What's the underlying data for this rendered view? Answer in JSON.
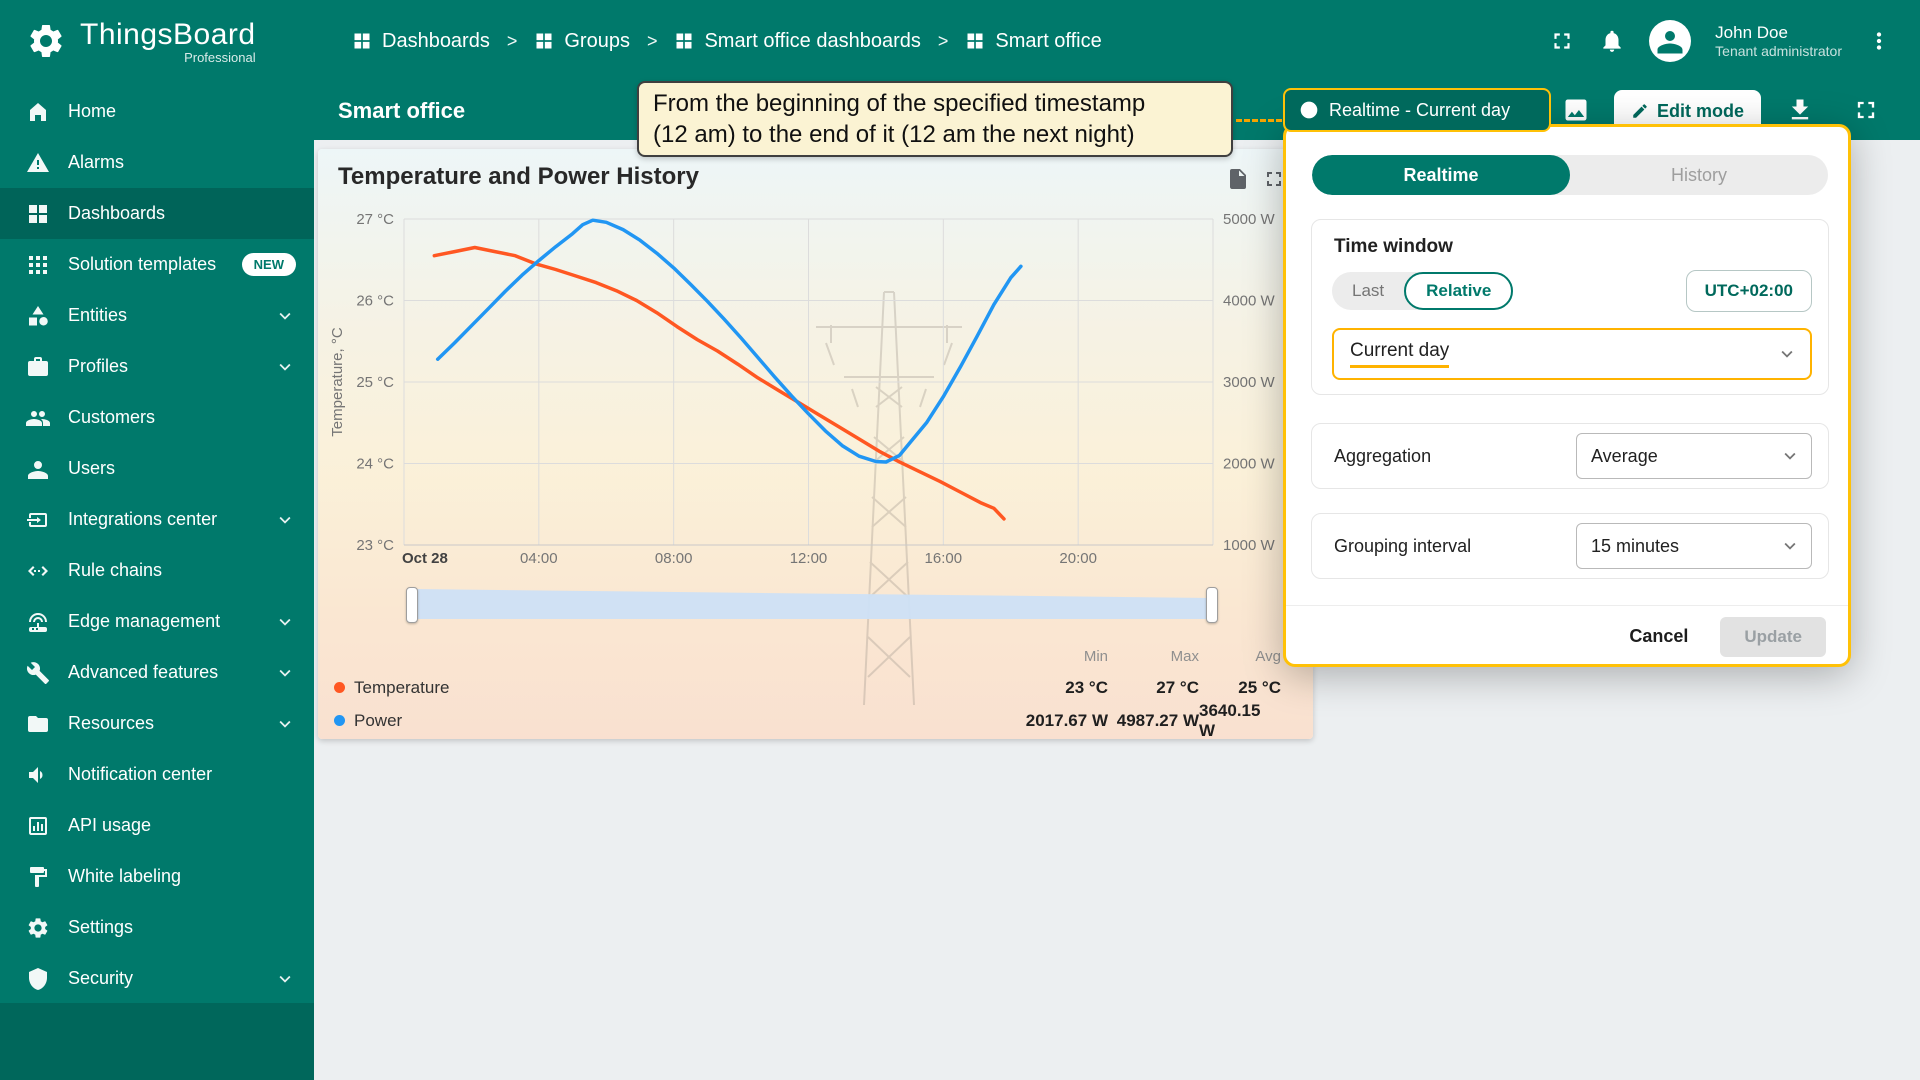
{
  "app": {
    "name": "ThingsBoard",
    "subtitle": "Professional"
  },
  "header": {
    "breadcrumbs": [
      {
        "label": "Dashboards"
      },
      {
        "label": "Groups"
      },
      {
        "label": "Smart office dashboards"
      },
      {
        "label": "Smart office"
      }
    ],
    "user": {
      "name": "John Doe",
      "role": "Tenant administrator"
    }
  },
  "sidebar": {
    "items": [
      {
        "label": "Home",
        "icon": "home-icon"
      },
      {
        "label": "Alarms",
        "icon": "alarms-icon"
      },
      {
        "label": "Dashboards",
        "icon": "dashboards-icon",
        "active": true
      },
      {
        "label": "Solution templates",
        "icon": "solution-templates-icon",
        "badge": "NEW"
      },
      {
        "label": "Entities",
        "icon": "entities-icon",
        "expandable": true
      },
      {
        "label": "Profiles",
        "icon": "profiles-icon",
        "expandable": true
      },
      {
        "label": "Customers",
        "icon": "customers-icon"
      },
      {
        "label": "Users",
        "icon": "users-icon"
      },
      {
        "label": "Integrations center",
        "icon": "integrations-icon",
        "expandable": true
      },
      {
        "label": "Rule chains",
        "icon": "rule-chains-icon"
      },
      {
        "label": "Edge management",
        "icon": "edge-management-icon",
        "expandable": true
      },
      {
        "label": "Advanced features",
        "icon": "advanced-features-icon",
        "expandable": true
      },
      {
        "label": "Resources",
        "icon": "resources-icon",
        "expandable": true
      },
      {
        "label": "Notification center",
        "icon": "notification-center-icon"
      },
      {
        "label": "API usage",
        "icon": "api-usage-icon"
      },
      {
        "label": "White labeling",
        "icon": "white-labeling-icon"
      },
      {
        "label": "Settings",
        "icon": "settings-icon"
      },
      {
        "label": "Security",
        "icon": "security-icon",
        "expandable": true
      }
    ]
  },
  "toolbar": {
    "title": "Smart office",
    "timewindow_button": "Realtime - Current day",
    "edit_button": "Edit mode"
  },
  "annotation": {
    "line1": "From the beginning of the specified timestamp",
    "line2": "(12 am) to the end of it (12 am the next night)"
  },
  "widget": {
    "title": "Temperature and Power History"
  },
  "chart_data": {
    "type": "line",
    "title": "Temperature and Power History",
    "x_ticks": [
      "Oct 28",
      "04:00",
      "08:00",
      "12:00",
      "16:00",
      "20:00"
    ],
    "x_tick_hours": [
      0,
      4,
      8,
      12,
      16,
      20
    ],
    "x_range_hours": [
      0,
      24
    ],
    "grid": true,
    "y_left": {
      "label": "Temperature, °C",
      "ticks": [
        "27 °C",
        "26 °C",
        "25 °C",
        "24 °C",
        "23 °C"
      ],
      "range": [
        23,
        27
      ]
    },
    "y_right": {
      "ticks": [
        "5000 W",
        "4000 W",
        "3000 W",
        "2000 W",
        "1000 W"
      ],
      "range": [
        1000,
        5000
      ]
    },
    "series": [
      {
        "name": "Temperature",
        "axis": "left",
        "color": "#ff5722",
        "points": [
          [
            0.9,
            26.55
          ],
          [
            1.5,
            26.6
          ],
          [
            2.1,
            26.65
          ],
          [
            2.7,
            26.6
          ],
          [
            3.3,
            26.55
          ],
          [
            3.9,
            26.45
          ],
          [
            4.5,
            26.38
          ],
          [
            5.1,
            26.3
          ],
          [
            5.7,
            26.22
          ],
          [
            6.3,
            26.12
          ],
          [
            6.9,
            26.0
          ],
          [
            7.5,
            25.85
          ],
          [
            8.1,
            25.68
          ],
          [
            8.7,
            25.52
          ],
          [
            9.3,
            25.38
          ],
          [
            9.9,
            25.22
          ],
          [
            10.5,
            25.05
          ],
          [
            11.1,
            24.9
          ],
          [
            11.7,
            24.75
          ],
          [
            12.3,
            24.6
          ],
          [
            12.9,
            24.45
          ],
          [
            13.5,
            24.3
          ],
          [
            14.1,
            24.15
          ],
          [
            14.7,
            24.02
          ],
          [
            15.3,
            23.9
          ],
          [
            15.9,
            23.78
          ],
          [
            16.5,
            23.65
          ],
          [
            17.1,
            23.52
          ],
          [
            17.5,
            23.45
          ],
          [
            17.8,
            23.32
          ]
        ]
      },
      {
        "name": "Power",
        "axis": "right",
        "color": "#2196f3",
        "points": [
          [
            1.0,
            3280
          ],
          [
            1.5,
            3480
          ],
          [
            2.0,
            3690
          ],
          [
            2.5,
            3900
          ],
          [
            3.0,
            4110
          ],
          [
            3.5,
            4310
          ],
          [
            4.0,
            4490
          ],
          [
            4.5,
            4660
          ],
          [
            5.0,
            4820
          ],
          [
            5.3,
            4930
          ],
          [
            5.6,
            4985
          ],
          [
            6.0,
            4960
          ],
          [
            6.5,
            4870
          ],
          [
            7.0,
            4740
          ],
          [
            7.5,
            4580
          ],
          [
            8.0,
            4400
          ],
          [
            8.5,
            4200
          ],
          [
            9.0,
            3990
          ],
          [
            9.5,
            3770
          ],
          [
            10.0,
            3540
          ],
          [
            10.5,
            3300
          ],
          [
            11.0,
            3060
          ],
          [
            11.5,
            2830
          ],
          [
            12.0,
            2610
          ],
          [
            12.5,
            2400
          ],
          [
            13.0,
            2220
          ],
          [
            13.5,
            2090
          ],
          [
            14.0,
            2025
          ],
          [
            14.3,
            2018
          ],
          [
            14.7,
            2100
          ],
          [
            15.0,
            2250
          ],
          [
            15.5,
            2500
          ],
          [
            16.0,
            2820
          ],
          [
            16.5,
            3180
          ],
          [
            17.0,
            3560
          ],
          [
            17.5,
            3950
          ],
          [
            18.0,
            4280
          ],
          [
            18.3,
            4420
          ]
        ]
      }
    ],
    "summary": {
      "headers": [
        "Min",
        "Max",
        "Avg"
      ],
      "rows": [
        {
          "name": "Temperature",
          "min": "23 °C",
          "max": "27 °C",
          "avg": "25 °C"
        },
        {
          "name": "Power",
          "min": "2017.67 W",
          "max": "4987.27 W",
          "avg": "3640.15 W"
        }
      ]
    }
  },
  "popup": {
    "tabs": [
      {
        "label": "Realtime",
        "active": true
      },
      {
        "label": "History"
      }
    ],
    "time_window": {
      "heading": "Time window",
      "last_label": "Last",
      "relative_label": "Relative",
      "timezone": "UTC+02:00",
      "interval_value": "Current day"
    },
    "aggregation": {
      "label": "Aggregation",
      "value": "Average"
    },
    "grouping": {
      "label": "Grouping interval",
      "value": "15 minutes"
    },
    "cancel_label": "Cancel",
    "update_label": "Update"
  },
  "colors": {
    "primary": "#00796b",
    "accent": "#ffc107",
    "temperature": "#ff5722",
    "power": "#2196f3"
  }
}
